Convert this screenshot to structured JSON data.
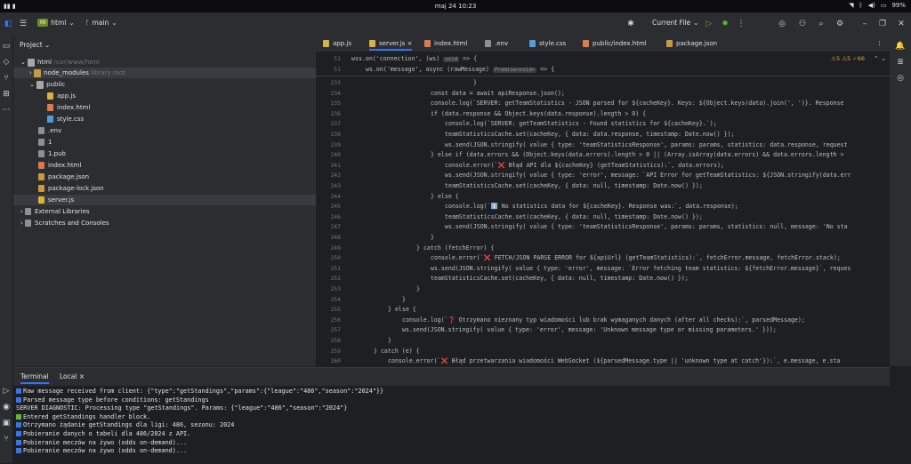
{
  "sys": {
    "date": "maj 24  10:23",
    "battery": "99%"
  },
  "title": {
    "project_badge": "HI",
    "project_name": "html",
    "branch": "main",
    "run_config": "Current File"
  },
  "project_panel": {
    "header": "Project",
    "root_name": "html",
    "root_path": "/var/www/html",
    "node_modules": "node_modules",
    "node_modules_note": "library root",
    "public": "public",
    "public_files": [
      "app.js",
      "index.html",
      "style.css"
    ],
    "root_files": [
      ".env",
      "1",
      "1.pub",
      "index.html",
      "package.json",
      "package-lock.json",
      "server.js"
    ],
    "external": "External Libraries",
    "scratches": "Scratches and Consoles"
  },
  "tabs": [
    "app.js",
    "server.js",
    "index.html",
    ".env",
    "style.css",
    "public/index.html",
    "package.json"
  ],
  "inspections": {
    "warnings": "5",
    "weak": "5",
    "typos": "66"
  },
  "sticky": {
    "line1_num": "51",
    "line1": "wss.on('connection', (ws)",
    "line1_hint": "void",
    "line1_end": " => {",
    "line2_num": "51",
    "line2": "ws.on('message', async (rawMessage)",
    "line2_hint": "Promise<void>",
    "line2_end": " => {"
  },
  "code_lines": [
    {
      "n": "233",
      "t": "}"
    },
    {
      "n": "234",
      "t": "const data = await apiResponse.json();"
    },
    {
      "n": "235",
      "t": "console.log(`SERVER: getTeamStatistics - JSON parsed for ${cacheKey}. Keys: ${Object.keys(data).join(', ')}. Response"
    },
    {
      "n": "236",
      "t": "if (data.response && Object.keys(data.response).length > 0) {"
    },
    {
      "n": "237",
      "t": "console.log(`SERVER: getTeamStatistics - Found statistics for ${cacheKey}.`);"
    },
    {
      "n": "238",
      "t": "teamStatisticsCache.set(cacheKey, { data: data.response, timestamp: Date.now() });"
    },
    {
      "n": "239",
      "t": "ws.send(JSON.stringify( value { type: 'teamStatisticsResponse', params: params, statistics: data.response, request"
    },
    {
      "n": "240",
      "t": "} else if (data.errors && (Object.keys(data.errors).length > 0 || (Array.isArray(data.errors) && data.errors.length >"
    },
    {
      "n": "241",
      "t": "console.error(`❌ Błąd API dla ${cacheKey} (getTeamStatistics):`, data.errors);"
    },
    {
      "n": "242",
      "t": "ws.send(JSON.stringify( value { type: 'error', message: `API Error for getTeamStatistics: ${JSON.stringify(data.err"
    },
    {
      "n": "243",
      "t": "teamStatisticsCache.set(cacheKey, { data: null, timestamp: Date.now() });"
    },
    {
      "n": "244",
      "t": "} else {"
    },
    {
      "n": "245",
      "t": "console.log(`ℹ️ No statistics data for ${cacheKey}. Response was:`, data.response);"
    },
    {
      "n": "246",
      "t": "teamStatisticsCache.set(cacheKey, { data: null, timestamp: Date.now() });"
    },
    {
      "n": "247",
      "t": "ws.send(JSON.stringify( value { type: 'teamStatisticsResponse', params: params, statistics: null, message: 'No sta"
    },
    {
      "n": "248",
      "t": "}"
    },
    {
      "n": "249",
      "t": "} catch (fetchError) {"
    },
    {
      "n": "250",
      "t": "console.error(`❌ FETCH/JSON PARSE ERROR for ${apiUrl} (getTeamStatistics):`, fetchError.message, fetchError.stack);"
    },
    {
      "n": "251",
      "t": "ws.send(JSON.stringify( value { type: 'error', message: `Error fetching team statistics: ${fetchError.message}`, reques"
    },
    {
      "n": "252",
      "t": "teamStatisticsCache.set(cacheKey, { data: null, timestamp: Date.now() });"
    },
    {
      "n": "253",
      "t": "}"
    },
    {
      "n": "254",
      "t": "}"
    },
    {
      "n": "255",
      "t": "} else {"
    },
    {
      "n": "256",
      "t": "console.log(`❓ Otrzymano nieznany typ wiadomości lub brak wymaganych danych (after all checks):`, parsedMessage);"
    },
    {
      "n": "257",
      "t": "ws.send(JSON.stringify( value { type: 'error', message: 'Unknown message type or missing parameters.' }));"
    },
    {
      "n": "258",
      "t": "}"
    },
    {
      "n": "259",
      "t": "} catch (e) {"
    },
    {
      "n": "260",
      "t": "console.error(`❌ Błąd przetwarzania wiadomości WebSocket (${parsedMessage.type || 'unknown type at catch'}):`, e.message, e.sta"
    }
  ],
  "terminal": {
    "tab_terminal": "Terminal",
    "tab_local": "Local",
    "lines": [
      "Raw message received from client: {\"type\":\"getStandings\",\"params\":{\"league\":\"486\",\"season\":\"2024\"}}",
      "Parsed message type before conditions: getStandings",
      "SERVER DIAGNOSTIC: Processing type \"getStandings\". Params: {\"league\":\"486\",\"season\":\"2024\"}",
      "Entered getStandings handler block.",
      "Otrzymano żądanie getStandings dla ligi: 486, sezonu: 2024",
      "Pobieranie danych o tabeli dla 486/2024 z API.",
      "Pobieranie meczów na żywo (odds on-demand)...",
      "Pobieranie meczów na żywo (odds on-demand)..."
    ]
  }
}
